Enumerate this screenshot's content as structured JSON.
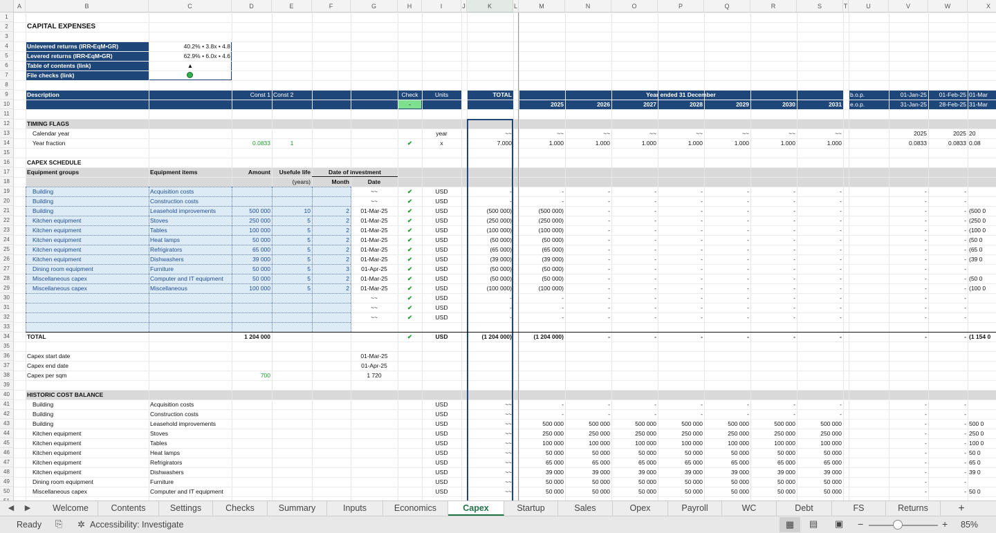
{
  "columns": [
    "A",
    "B",
    "C",
    "D",
    "E",
    "F",
    "G",
    "H",
    "I",
    "J",
    "K",
    "L",
    "M",
    "N",
    "O",
    "P",
    "Q",
    "R",
    "S",
    "T",
    "U",
    "V",
    "W",
    "X"
  ],
  "sheet_title": "CAPITAL EXPENSES",
  "summary_box": {
    "rows": [
      {
        "label": "Unlevered returns (IRR•EqM•GR)",
        "value": "40.2% • 3.8x • 4.8"
      },
      {
        "label": "Levered returns (IRR•EqM•GR)",
        "value": "62.9% • 6.0x • 4.6"
      },
      {
        "label": "Table of contents (link)",
        "value": "▲"
      },
      {
        "label": "File checks (link)",
        "value": ""
      }
    ]
  },
  "header": {
    "description": "Description",
    "const1": "Const 1",
    "const2": "Const 2",
    "check": "Check",
    "check_value": "-",
    "units": "Units",
    "total": "TOTAL",
    "year_ended": "Year ended 31 December",
    "years": [
      "2025",
      "2026",
      "2027",
      "2028",
      "2029",
      "2030",
      "2031"
    ],
    "bop": "b.o.p.",
    "eop": "e.o.p.",
    "monthly_start": [
      "01-Jan-25",
      "01-Feb-25",
      "01-Mar"
    ],
    "monthly_end": [
      "31-Jan-25",
      "28-Feb-25",
      "31-Mar"
    ]
  },
  "timing": {
    "section": "TIMING FLAGS",
    "calendar_label": "Calendar year",
    "calendar_unit": "year",
    "calendar_tilde": "~~",
    "calendar_monthly": [
      "2025",
      "2025",
      "20"
    ],
    "fraction_label": "Year fraction",
    "fraction_c1": "0.0833",
    "fraction_c2": "1",
    "fraction_check": "✔",
    "fraction_unit": "x",
    "fraction_total": "7.000",
    "fraction_year": "1.000",
    "fraction_monthly": [
      "0.0833",
      "0.0833",
      "0.08"
    ]
  },
  "capex": {
    "section": "CAPEX SCHEDULE",
    "hdr_groups": "Equipment groups",
    "hdr_items": "Equipment items",
    "hdr_amount": "Amount",
    "hdr_life": "Usefule life",
    "hdr_life2": "(years)",
    "hdr_doi": "Date of investment",
    "hdr_month": "Month",
    "hdr_date": "Date",
    "rows": [
      {
        "g": "Building",
        "i": "Acquisition costs",
        "a": "",
        "l": "",
        "m": "",
        "d": "~~",
        "tot": "-",
        "y1": "-",
        "m3": ""
      },
      {
        "g": "Building",
        "i": "Construction costs",
        "a": "",
        "l": "",
        "m": "",
        "d": "~~",
        "tot": "-",
        "y1": "-",
        "m3": ""
      },
      {
        "g": "Building",
        "i": "Leasehold improvements",
        "a": "500 000",
        "l": "10",
        "m": "2",
        "d": "01-Mar-25",
        "tot": "(500 000)",
        "y1": "(500 000)",
        "m3": "(500 0"
      },
      {
        "g": "Kitchen equipment",
        "i": "Stoves",
        "a": "250 000",
        "l": "5",
        "m": "2",
        "d": "01-Mar-25",
        "tot": "(250 000)",
        "y1": "(250 000)",
        "m3": "(250 0"
      },
      {
        "g": "Kitchen equipment",
        "i": "Tables",
        "a": "100 000",
        "l": "5",
        "m": "2",
        "d": "01-Mar-25",
        "tot": "(100 000)",
        "y1": "(100 000)",
        "m3": "(100 0"
      },
      {
        "g": "Kitchen equipment",
        "i": "Heat lamps",
        "a": "50 000",
        "l": "5",
        "m": "2",
        "d": "01-Mar-25",
        "tot": "(50 000)",
        "y1": "(50 000)",
        "m3": "(50 0"
      },
      {
        "g": "Kitchen equipment",
        "i": "Refrigirators",
        "a": "65 000",
        "l": "5",
        "m": "2",
        "d": "01-Mar-25",
        "tot": "(65 000)",
        "y1": "(65 000)",
        "m3": "(65 0"
      },
      {
        "g": "Kitchen equipment",
        "i": "Dishwashers",
        "a": "39 000",
        "l": "5",
        "m": "2",
        "d": "01-Mar-25",
        "tot": "(39 000)",
        "y1": "(39 000)",
        "m3": "(39 0"
      },
      {
        "g": "Dining room equipment",
        "i": "Furniture",
        "a": "50 000",
        "l": "5",
        "m": "3",
        "d": "01-Apr-25",
        "tot": "(50 000)",
        "y1": "(50 000)",
        "m3": ""
      },
      {
        "g": "Miscellaneous capex",
        "i": "Computer and IT equipment",
        "a": "50 000",
        "l": "5",
        "m": "2",
        "d": "01-Mar-25",
        "tot": "(50 000)",
        "y1": "(50 000)",
        "m3": "(50 0"
      },
      {
        "g": "Miscellaneous capex",
        "i": "Miscellaneous",
        "a": "100 000",
        "l": "5",
        "m": "2",
        "d": "01-Mar-25",
        "tot": "(100 000)",
        "y1": "(100 000)",
        "m3": "(100 0"
      },
      {
        "g": "",
        "i": "",
        "a": "",
        "l": "",
        "m": "",
        "d": "~~",
        "tot": "-",
        "y1": "-",
        "m3": ""
      },
      {
        "g": "",
        "i": "",
        "a": "",
        "l": "",
        "m": "",
        "d": "~~",
        "tot": "-",
        "y1": "-",
        "m3": ""
      },
      {
        "g": "",
        "i": "",
        "a": "",
        "l": "",
        "m": "",
        "d": "~~",
        "tot": "-",
        "y1": "-",
        "m3": ""
      }
    ],
    "unit": "USD",
    "check": "✔",
    "dash": "-",
    "total_label": "TOTAL",
    "total_amount": "1 204 000",
    "total_total": "(1 204 000)",
    "total_y1": "(1 204 000)",
    "total_m3": "(1 154 0"
  },
  "capex_dates": [
    {
      "label": "Capex start date",
      "value": "01-Mar-25"
    },
    {
      "label": "Capex end date",
      "value": "01-Apr-25"
    },
    {
      "label": "Capex per sqm",
      "value": "1 720",
      "const": "700"
    }
  ],
  "historic": {
    "section": "HISTORIC COST BALANCE",
    "rows": [
      {
        "g": "Building",
        "i": "Acquisition costs",
        "y": "-",
        "m3": ""
      },
      {
        "g": "Building",
        "i": "Construction costs",
        "y": "-",
        "m3": ""
      },
      {
        "g": "Building",
        "i": "Leasehold improvements",
        "y": "500 000",
        "m3": "500 0"
      },
      {
        "g": "Kitchen equipment",
        "i": "Stoves",
        "y": "250 000",
        "m3": "250 0"
      },
      {
        "g": "Kitchen equipment",
        "i": "Tables",
        "y": "100 000",
        "m3": "100 0"
      },
      {
        "g": "Kitchen equipment",
        "i": "Heat lamps",
        "y": "50 000",
        "m3": "50 0"
      },
      {
        "g": "Kitchen equipment",
        "i": "Refrigirators",
        "y": "65 000",
        "m3": "65 0"
      },
      {
        "g": "Kitchen equipment",
        "i": "Dishwashers",
        "y": "39 000",
        "m3": "39 0"
      },
      {
        "g": "Dining room equipment",
        "i": "Furniture",
        "y": "50 000",
        "m3": ""
      },
      {
        "g": "Miscellaneous capex",
        "i": "Computer and IT equipment",
        "y": "50 000",
        "m3": "50 0"
      }
    ],
    "unit": "USD",
    "tilde": "~~"
  },
  "tabs": [
    "Welcome",
    "Contents",
    "Settings",
    "Checks",
    "Summary",
    "Inputs",
    "Economics",
    "Capex",
    "Startup",
    "Sales",
    "Opex",
    "Payroll",
    "WC",
    "Debt",
    "FS",
    "Returns"
  ],
  "active_tab": "Capex",
  "add_sheet": "+",
  "status": {
    "ready": "Ready",
    "accessibility": "Accessibility: Investigate",
    "zoom": "85%",
    "minus": "−",
    "plus": "+"
  }
}
